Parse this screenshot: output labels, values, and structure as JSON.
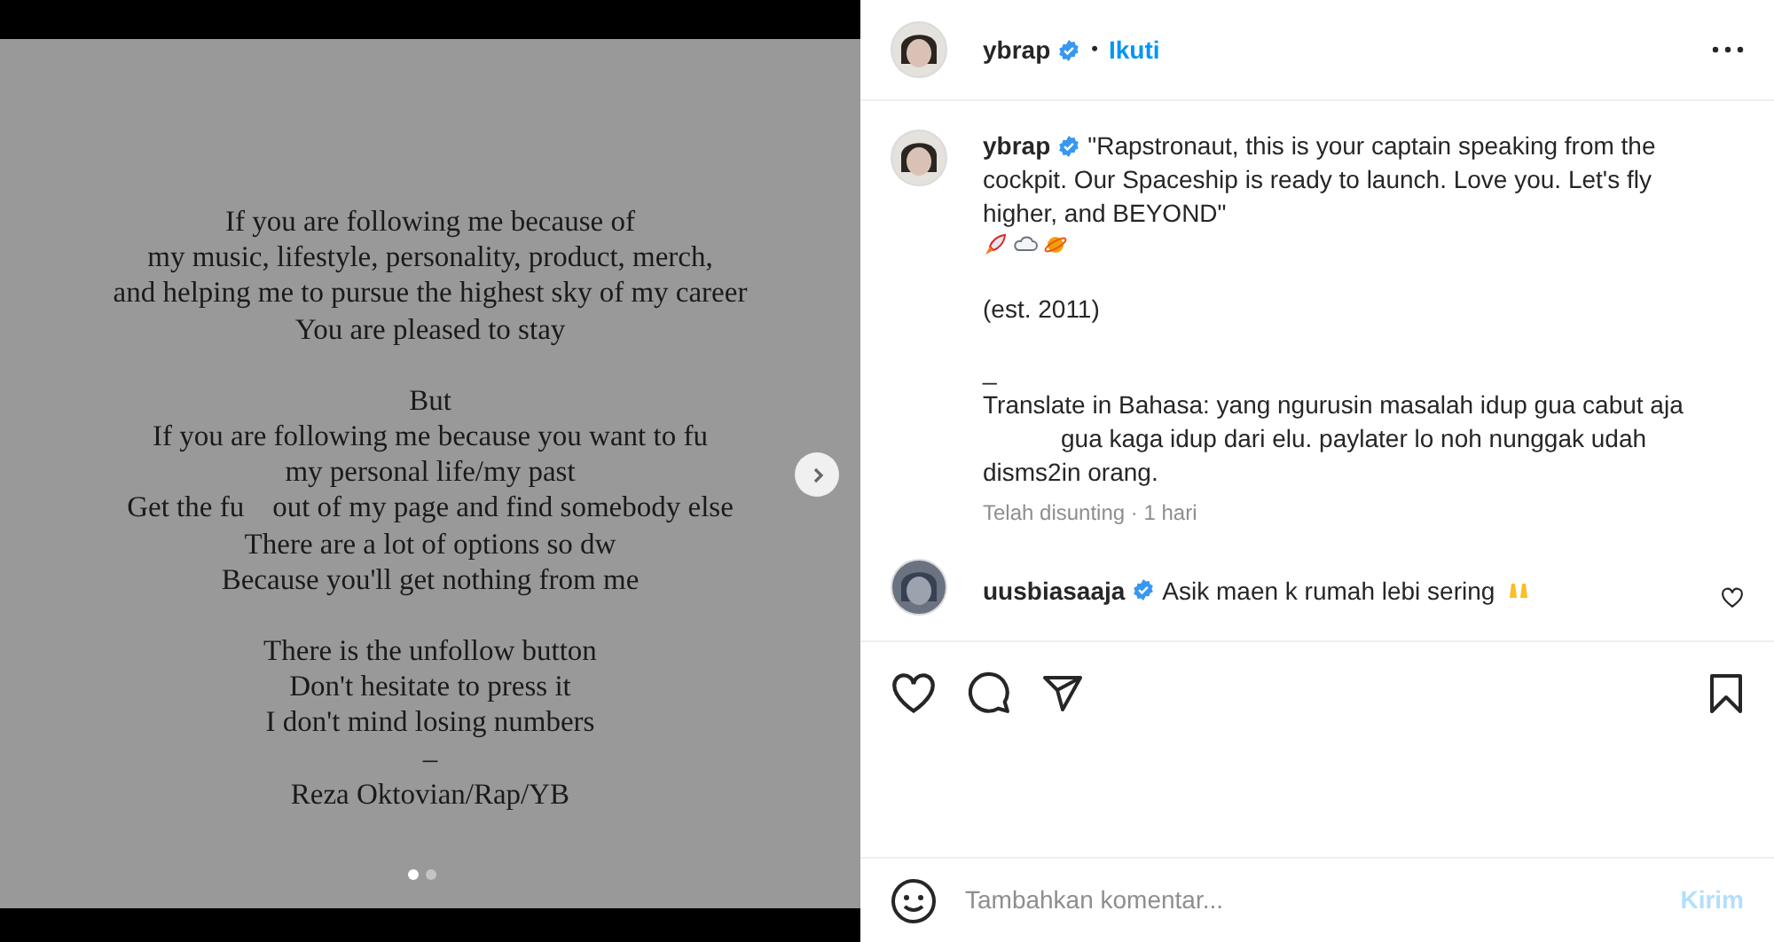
{
  "slide": {
    "paragraphs": [
      {
        "lines": [
          [
            "If you are following me because of"
          ],
          [
            "my music, lifestyle, personality, product, merch,"
          ],
          [
            "and helping me to pursue the highest sky of my career"
          ],
          [
            "You are pleased to stay"
          ]
        ]
      },
      {
        "lines": [
          [
            "But"
          ],
          [
            "If you are following me because you want to fu"
          ],
          [
            "my personal life/my past"
          ],
          [
            "Get the fu",
            "out of my page and find somebody else"
          ],
          [
            "There are a lot of options so dw"
          ],
          [
            "Because you'll get nothing from me"
          ]
        ]
      },
      {
        "lines": [
          [
            "There is the unfollow button"
          ],
          [
            "Don't hesitate to press it"
          ],
          [
            "I don't mind losing numbers"
          ],
          [
            "–"
          ],
          [
            "Reza Oktovian/Rap/YB"
          ]
        ]
      }
    ],
    "dots": [
      {
        "selected": true
      },
      {
        "selected": false
      }
    ]
  },
  "header": {
    "username": "ybrap",
    "verified": true,
    "separator": "•",
    "follow": "Ikuti"
  },
  "caption": {
    "username": "ybrap",
    "verified": true,
    "lines": [
      "\"Rapstronaut, this is your captain speaking from the cockpit. Our Spaceship is ready to launch. Love you. Let's fly higher, and BEYOND\""
    ],
    "est": "(est. 2011)",
    "dash": "_",
    "translate_1": "Translate in Bahasa: yang ngurusin masalah idup gua cabut aja",
    "translate_2": "gua kaga idup dari elu. paylater lo noh nunggak udah",
    "translate_3": "disms2in orang.",
    "meta": "Telah disunting · 1 hari"
  },
  "comments": [
    {
      "username": "uusbiasaaja",
      "verified": true,
      "text": "Asik maen k rumah lebi sering",
      "liked": false
    }
  ],
  "comment_box": {
    "placeholder": "Tambahkan komentar...",
    "submit": "Kirim"
  }
}
